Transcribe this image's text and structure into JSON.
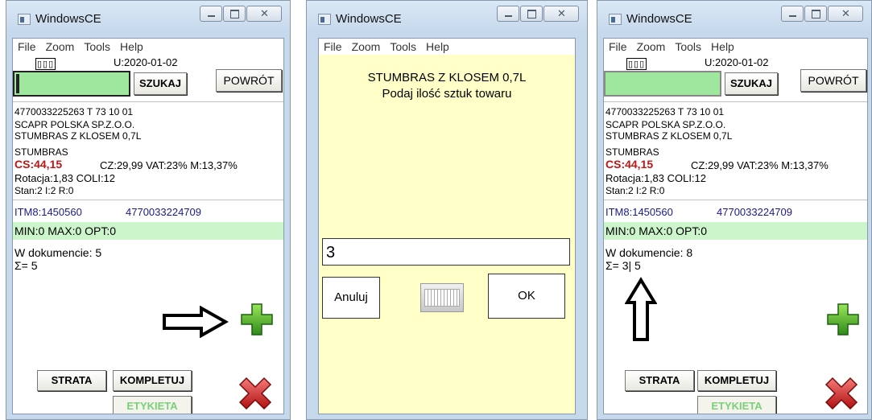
{
  "window": {
    "title": "WindowsCE",
    "menu": [
      "File",
      "Zoom",
      "Tools",
      "Help"
    ]
  },
  "product": {
    "barcode_icon": "▯▯▯",
    "user_date": "U:2020-01-02",
    "search_label": "SZUKAJ",
    "back_label": "POWRÓT",
    "ean_line": "4770033225263  T  73 10 01",
    "supplier": "SCAPR POLSKA SP.Z.O.O.",
    "name": "STUMBRAS Z KLOSEM 0,7L",
    "brand": "STUMBRAS",
    "cs": "CS:44,15",
    "prices": "CZ:29,99  VAT:23%  M:13,37%",
    "rotation": "Rotacja:1,83   COLI:12",
    "stock": "Stan:2  I:2  R:0",
    "itm": "ITM8:1450560",
    "ean2": "4770033224709",
    "minmax": "MIN:0 MAX:0 OPT:0",
    "strata_label": "STRATA",
    "kompletuj_label": "KOMPLETUJ",
    "etykieta_label": "ETYKIETA"
  },
  "screen1": {
    "doc_count": "W dokumencie: 5",
    "sum": "Σ= 5"
  },
  "screen3": {
    "doc_count": "W dokumencie: 8",
    "sum": "Σ= 3| 5"
  },
  "dialog": {
    "product_name": "STUMBRAS Z KLOSEM 0,7L",
    "prompt": "Podaj ilość sztuk towaru",
    "quantity_value": "3",
    "cancel_label": "Anuluj",
    "ok_label": "OK",
    "keyboard_icon": "keyboard-icon"
  },
  "icons": {
    "plus": "plus-icon",
    "close": "red-x-icon",
    "arrow_right": "arrow-right-icon",
    "arrow_up": "arrow-up-icon"
  },
  "colors": {
    "search_green": "#9fe69f",
    "minmax_green": "#ccf5cc",
    "dialog_yellow": "#ffffc8",
    "cs_red": "#c21515",
    "itm_blue": "#1a1a8e"
  }
}
